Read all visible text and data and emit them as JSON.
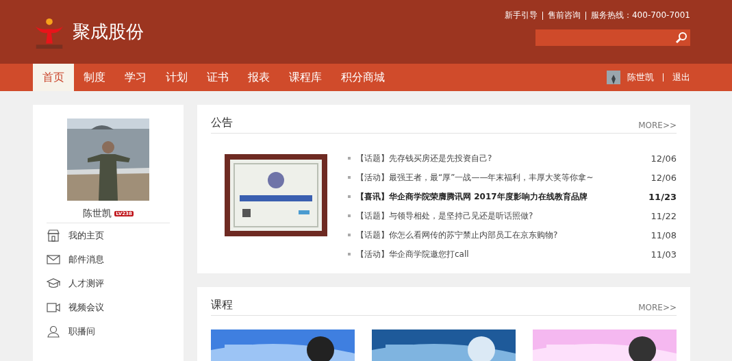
{
  "header": {
    "brand": "聚成股份",
    "top_links": [
      "新手引导",
      "售前咨询",
      "服务热线：400-700-7001"
    ]
  },
  "nav": {
    "items": [
      {
        "label": "首页",
        "selected": true
      },
      {
        "label": "制度",
        "selected": false
      },
      {
        "label": "学习",
        "selected": false
      },
      {
        "label": "计划",
        "selected": false
      },
      {
        "label": "证书",
        "selected": false
      },
      {
        "label": "报表",
        "selected": false
      },
      {
        "label": "课程库",
        "selected": false
      },
      {
        "label": "积分商城",
        "selected": false
      }
    ],
    "user": "陈世凯",
    "logout": "退出"
  },
  "profile": {
    "name": "陈世凯",
    "level": "LV238"
  },
  "sidebar": {
    "items": [
      {
        "label": "我的主页"
      },
      {
        "label": "邮件消息"
      },
      {
        "label": "人才测评"
      },
      {
        "label": "视频会议"
      },
      {
        "label": "职播间"
      }
    ]
  },
  "notices": {
    "title": "公告",
    "more": "MORE>>",
    "items": [
      {
        "text": "【话题】先存钱买房还是先投资自己?",
        "date": "12/06",
        "bold": false
      },
      {
        "text": "【活动】最强王者，最“厚”一战——年末福利，丰厚大奖等你拿~",
        "date": "12/06",
        "bold": false
      },
      {
        "text": "【喜讯】华企商学院荣膺腾讯网 2017年度影响力在线教育品牌",
        "date": "11/23",
        "bold": true
      },
      {
        "text": "【话题】与领导相处，是坚持己见还是听话照做?",
        "date": "11/22",
        "bold": false
      },
      {
        "text": "【话题】你怎么看网传的苏宁禁止内部员工在京东购物?",
        "date": "11/08",
        "bold": false
      },
      {
        "text": "【活动】华企商学院邀您打call",
        "date": "11/03",
        "bold": false
      }
    ]
  },
  "courses": {
    "title": "课程",
    "more": "MORE>>"
  }
}
